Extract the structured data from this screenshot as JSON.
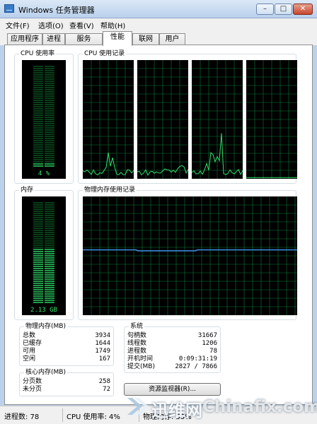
{
  "window": {
    "title": "Windows 任务管理器",
    "min_label": "–",
    "max_label": "□",
    "close_label": "✕"
  },
  "menu": [
    "文件(F)",
    "选项(O)",
    "查看(V)",
    "帮助(H)"
  ],
  "tabs": [
    "应用程序",
    "进程",
    "服务",
    "性能",
    "联网",
    "用户"
  ],
  "active_tab": "性能",
  "cpu_usage": {
    "label": "CPU 使用率",
    "value_text": "4 %",
    "level": 0.04
  },
  "cpu_history": {
    "label": "CPU 使用记录"
  },
  "memory": {
    "label": "内存",
    "value_text": "2.13 GB",
    "level": 0.55
  },
  "memory_history": {
    "label": "物理内存使用记录",
    "level": 0.55
  },
  "physical_memory": {
    "label": "物理内存(MB)",
    "rows": [
      {
        "name": "总数",
        "value": "3934"
      },
      {
        "name": "已缓存",
        "value": "1644"
      },
      {
        "name": "可用",
        "value": "1749"
      },
      {
        "name": "空闲",
        "value": "167"
      }
    ]
  },
  "kernel_memory": {
    "label": "核心内存(MB)",
    "rows": [
      {
        "name": "分页数",
        "value": "258"
      },
      {
        "name": "未分页",
        "value": "72"
      }
    ]
  },
  "system": {
    "label": "系统",
    "rows": [
      {
        "name": "句柄数",
        "value": "31667"
      },
      {
        "name": "线程数",
        "value": "1206"
      },
      {
        "name": "进程数",
        "value": "78"
      },
      {
        "name": "开机时间",
        "value": "0:09:31:19"
      },
      {
        "name": "提交(MB)",
        "value": "2827 / 7866"
      }
    ]
  },
  "resource_monitor_button": "资源监视器(R)...",
  "status": {
    "processes": "进程数: 78",
    "cpu": "CPU 使用率: 4%",
    "memory": "物理内存: 55%"
  },
  "watermark": {
    "cn": "迅维网",
    "en": "Chinafix.com"
  },
  "colors": {
    "graph_bg": "#000000",
    "grid": "#0a7a3a",
    "meter": "#2ee06a",
    "cpu_line": "#2ee06a",
    "mem_line": "#3b8bd6"
  }
}
